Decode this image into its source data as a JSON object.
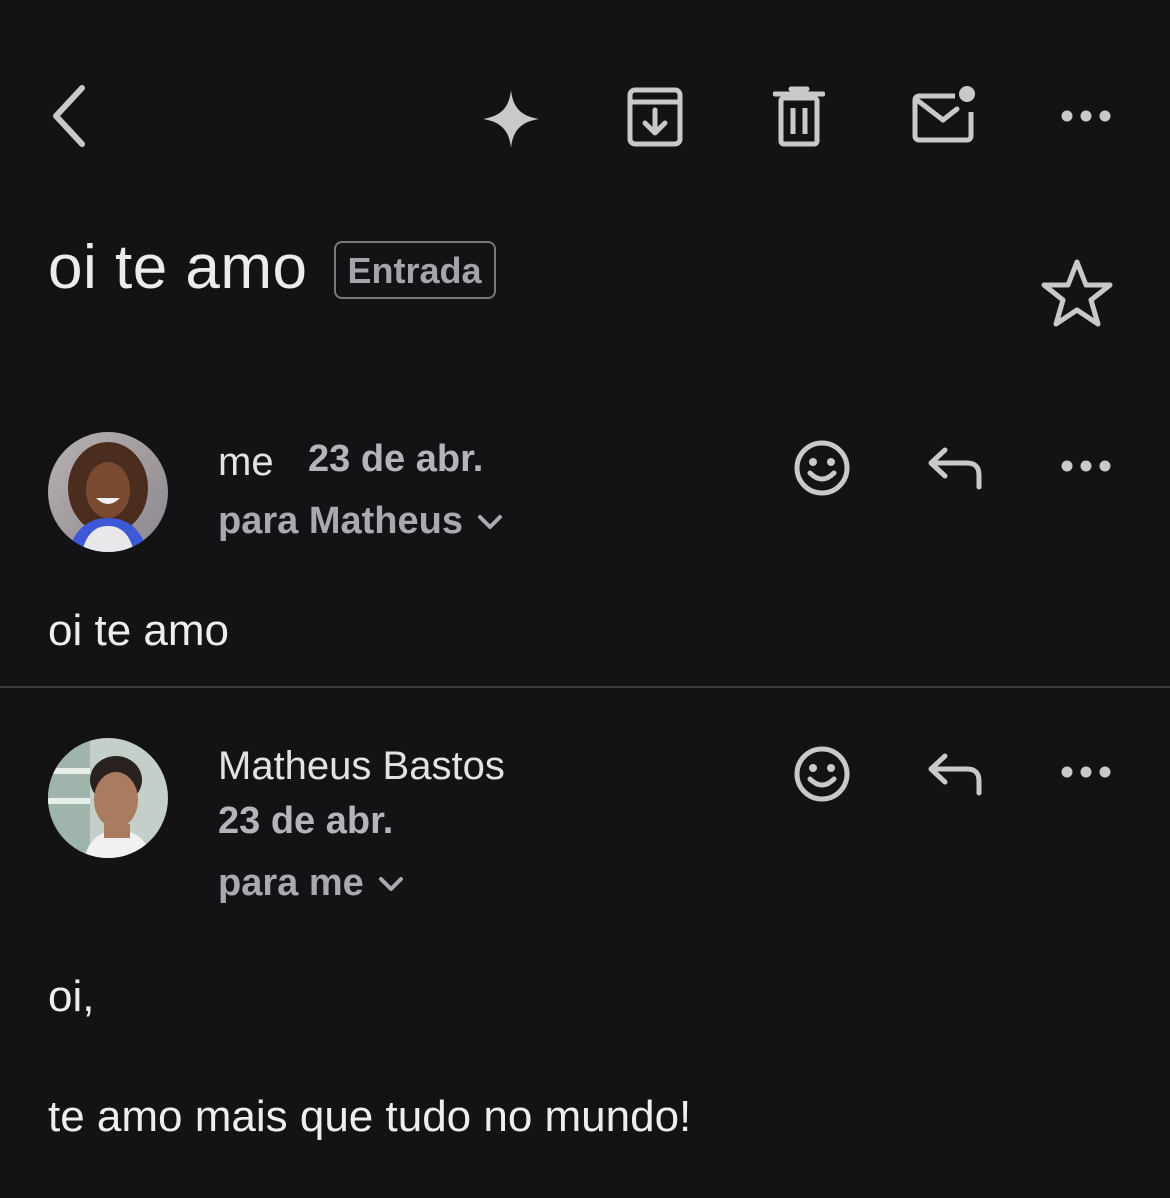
{
  "toolbar": {
    "icons": [
      "back-chevron-icon",
      "sparkle-icon",
      "archive-icon",
      "trash-icon",
      "mark-unread-icon",
      "more-horizontal-icon"
    ]
  },
  "subject": {
    "title": "oi te amo",
    "label": "Entrada"
  },
  "messages": [
    {
      "sender": "me",
      "date": "23 de abr.",
      "recipients": "para Matheus",
      "body": [
        "oi te amo"
      ]
    },
    {
      "sender": "Matheus Bastos",
      "date": "23 de abr.",
      "recipients": "para me",
      "body": [
        "oi,",
        "te amo mais que tudo no mundo!"
      ]
    }
  ],
  "colors": {
    "background": "#131316",
    "text": "#ececee",
    "icon": "#c9c9cc",
    "muted": "#a9aaaf"
  }
}
